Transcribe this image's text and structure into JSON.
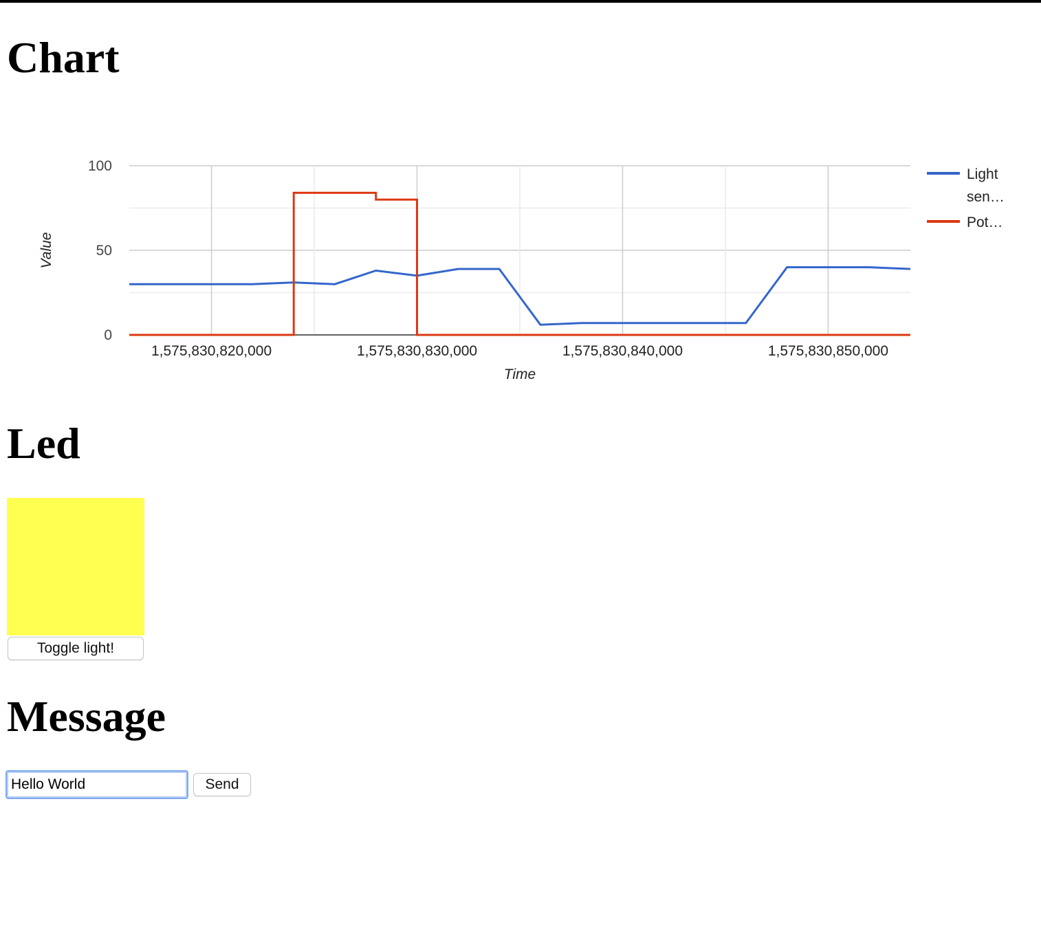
{
  "headings": {
    "chart": "Chart",
    "led": "Led",
    "message": "Message"
  },
  "chart_data": {
    "type": "line",
    "xlabel": "Time",
    "ylabel": "Value",
    "ylim": [
      0,
      100
    ],
    "xlim": [
      1575830816000,
      1575830854000
    ],
    "yticks": [
      {
        "value": 0,
        "label": "0"
      },
      {
        "value": 50,
        "label": "50"
      },
      {
        "value": 100,
        "label": "100"
      }
    ],
    "xticks": [
      {
        "value": 1575830820000,
        "label": "1,575,830,820,000"
      },
      {
        "value": 1575830830000,
        "label": "1,575,830,830,000"
      },
      {
        "value": 1575830840000,
        "label": "1,575,830,840,000"
      },
      {
        "value": 1575830850000,
        "label": "1,575,830,850,000"
      }
    ],
    "grid": true,
    "legend_position": "right",
    "series": [
      {
        "name": "Light sen…",
        "color": "#3366cc",
        "x": [
          1575830816000,
          1575830822000,
          1575830824000,
          1575830826000,
          1575830828000,
          1575830830000,
          1575830832000,
          1575830834000,
          1575830836000,
          1575830838000,
          1575830840000,
          1575830842000,
          1575830846000,
          1575830848000,
          1575830850000,
          1575830852000,
          1575830854000
        ],
        "y": [
          30,
          30,
          31,
          30,
          38,
          35,
          39,
          39,
          6,
          7,
          7,
          7,
          7,
          40,
          40,
          40,
          39
        ]
      },
      {
        "name": "Pot…",
        "color": "#dc3912",
        "x": [
          1575830816000,
          1575830824000,
          1575830824000,
          1575830828000,
          1575830828000,
          1575830830000,
          1575830830000,
          1575830854000
        ],
        "y": [
          0,
          0,
          84,
          84,
          80,
          80,
          0,
          0
        ]
      }
    ]
  },
  "legend_lines": [
    [
      "Light",
      "sen…"
    ],
    [
      "Pot…"
    ]
  ],
  "led": {
    "color": "#ffff4f",
    "button_label": "Toggle light!"
  },
  "message": {
    "input_value": "Hello World",
    "send_label": "Send"
  }
}
